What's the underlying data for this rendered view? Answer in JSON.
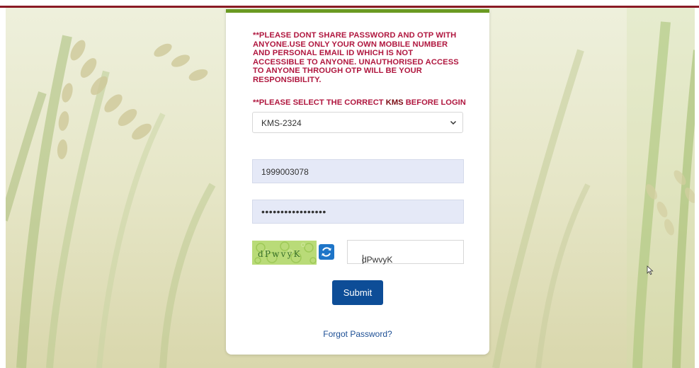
{
  "warning": {
    "lines": [
      "**PLEASE DONT SHARE PASSWORD AND OTP WITH",
      "ANYONE.USE ONLY YOUR OWN MOBILE NUMBER",
      "AND PERSONAL EMAIL ID WHICH IS NOT",
      "ACCESSIBLE TO ANYONE. UNAUTHORISED ACCESS",
      "TO ANYONE THROUGH OTP WILL BE YOUR",
      "RESPONSIBILITY."
    ]
  },
  "kms_note": {
    "prefix": "**PLEASE SELECT THE CORRECT ",
    "highlight": "KMS",
    "suffix": " BEFORE LOGIN"
  },
  "kms_select": {
    "value": "KMS-2324"
  },
  "mobile_input": {
    "value": "1999003078"
  },
  "password_input": {
    "value": "•••••••••••••••••"
  },
  "captcha": {
    "image_text": "dPwvyK",
    "input_value": "dPwvyK"
  },
  "submit": {
    "label": "Submit"
  },
  "forgot_password": {
    "label": "Forgot Password?"
  },
  "colors": {
    "warning_text": "#b0173f",
    "top_bar": "#8a1a25",
    "panel_accent": "#6a9a22",
    "submit_bg": "#0d4d97",
    "input_bg": "#e5e9f7",
    "link": "#1d4f95"
  },
  "icons": {
    "select_arrow": "chevron-down-icon",
    "refresh": "refresh-icon",
    "cursor": "mouse-pointer-icon"
  }
}
